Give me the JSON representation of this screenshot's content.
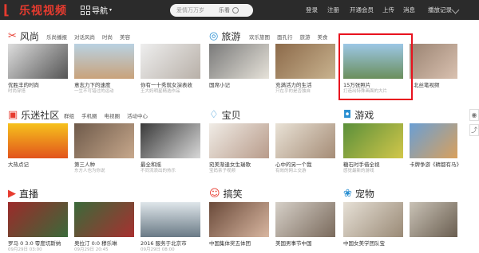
{
  "header": {
    "logo_text": "乐视视频",
    "nav_label": "导航",
    "search_placeholder": "爱情万万岁",
    "search_label": "乐看",
    "links": [
      "登录",
      "注册",
      "开通会员",
      "上传",
      "消息",
      "播放记录"
    ]
  },
  "sections": [
    {
      "title": "风尚",
      "subnav": [
        "乐尚播报",
        "对话风尚",
        "时尚",
        "美容"
      ],
      "items": [
        {
          "caption": "优胜丰的时尚",
          "sub": "时尚穿搭"
        },
        {
          "caption": "意志力下的速度",
          "sub": "一生不可错过的运动"
        },
        {
          "caption": "你有一十秀就女演表收",
          "sub": "王大妈明星精选作品"
        }
      ]
    },
    {
      "title": "旅游",
      "subnav": [
        "欢乐旅图",
        "面孔行",
        "旅游",
        "美食"
      ],
      "items": [
        {
          "caption": "国席小记",
          "sub": ""
        },
        {
          "caption": "充满活力的生活",
          "sub": "只在乎的是否独自"
        },
        {
          "caption": "15万张照片",
          "sub": "打造出特殊画面的大片"
        },
        {
          "caption": "北丝笔视频",
          "sub": ""
        }
      ]
    },
    {
      "title": "乐迷社区",
      "subnav": [
        "群组",
        "手机圈",
        "电视圈",
        "活动中心"
      ],
      "items": [
        {
          "caption": "大热点记",
          "sub": ""
        },
        {
          "caption": "第三人种",
          "sub": "东方人也为你说"
        },
        {
          "caption": "最全和摇",
          "sub": "不同流浪出的热乐"
        }
      ]
    },
    {
      "title": "宝贝",
      "subnav": [],
      "items": [
        {
          "caption": "宛美渐逢女生瑞歌",
          "sub": "宝妈亲子视频"
        },
        {
          "caption": "心中的另一个我",
          "sub": "有效的网上交游"
        },
        {
          "caption": "宛美渐逢美手巴卡",
          "sub": ""
        }
      ]
    },
    {
      "title": "游戏",
      "subnav": [],
      "items": [
        {
          "caption": "糖石时手借全视",
          "sub": "感觉最新的游戏"
        },
        {
          "caption": "卡牌争游《精都有马》",
          "sub": ""
        }
      ]
    },
    {
      "title": "直播",
      "subnav": [],
      "items": [
        {
          "caption": "罗马 0 3:0 零度切斯纳",
          "sub": "09月29日 03:00"
        },
        {
          "caption": "奥拉汀 0:0 穆乐琳",
          "sub": "09月29日 20:45"
        },
        {
          "caption": "2016 服务于北京市",
          "sub": "09月29日 08:00"
        }
      ]
    },
    {
      "title": "搞笑",
      "subnav": [],
      "items": [
        {
          "caption": "中国集体奖五体团",
          "sub": ""
        },
        {
          "caption": "美国男事节中国",
          "sub": ""
        }
      ]
    },
    {
      "title": "宠物",
      "subnav": [],
      "items": [
        {
          "caption": "中国女美学团队宝",
          "sub": ""
        },
        {
          "caption": "",
          "sub": ""
        }
      ]
    }
  ],
  "colors": {
    "accent": "#e73b2f",
    "highlight": "#e8121e",
    "topbar": "#2b2b2b"
  }
}
